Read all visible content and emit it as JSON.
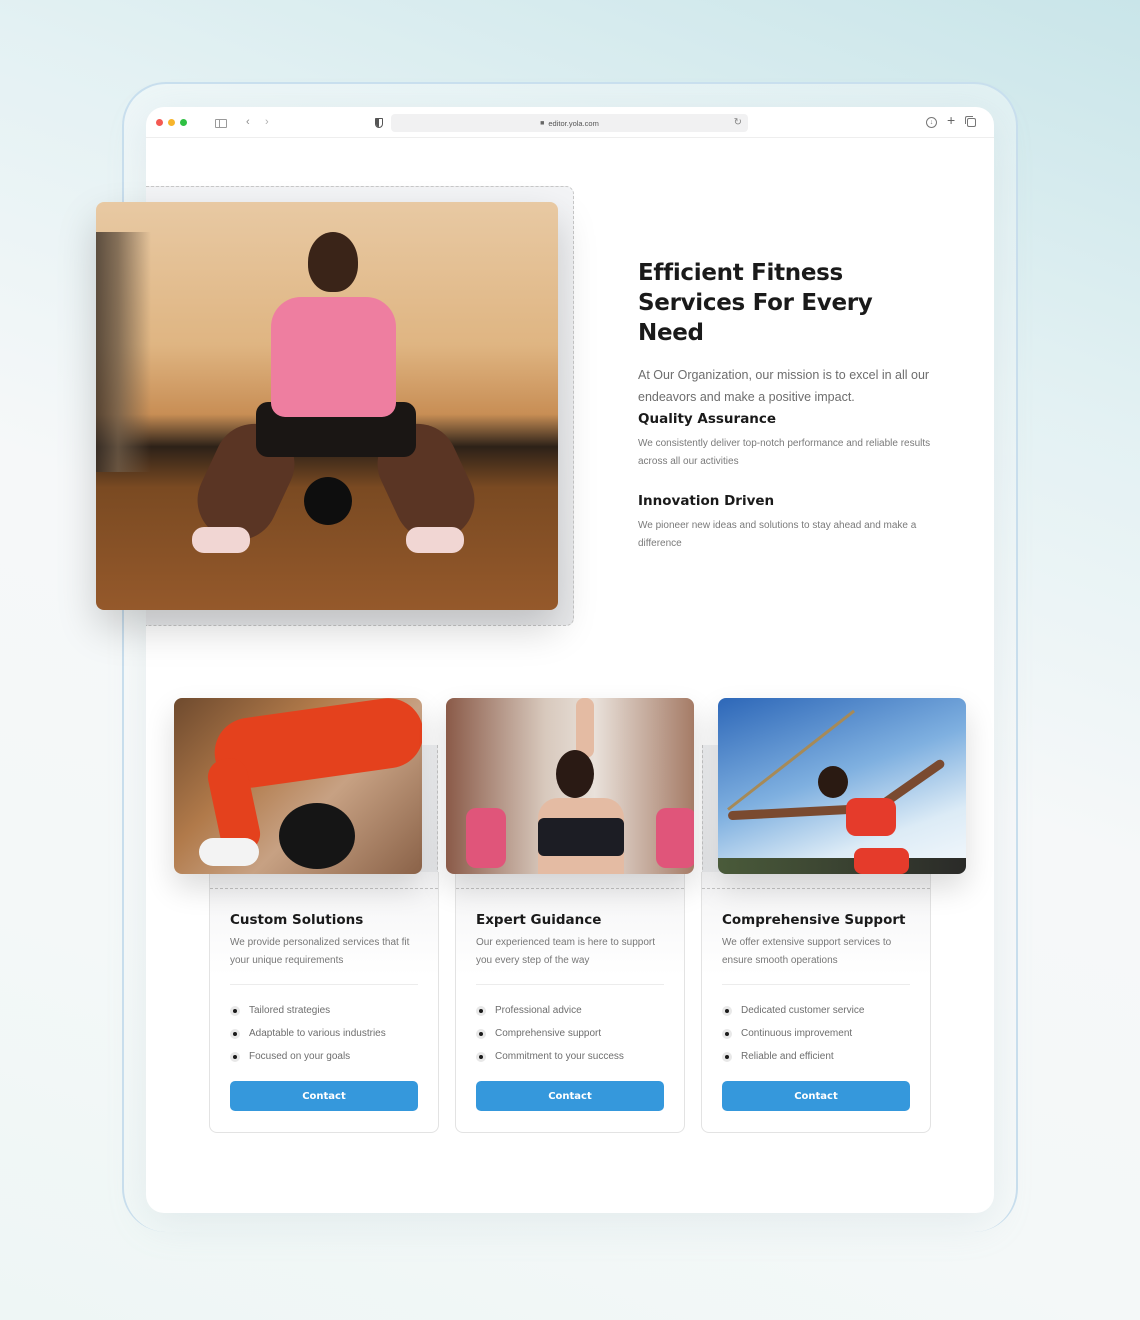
{
  "browser": {
    "url": "editor.yola.com",
    "icons": {
      "traffic_lights": [
        "close",
        "minimize",
        "maximize"
      ],
      "sidebar": "sidebar-toggle-icon",
      "back": "chevron-left-icon",
      "forward": "chevron-right-icon",
      "shield": "privacy-shield-icon",
      "lock": "lock-icon",
      "reload": "reload-icon",
      "download": "download-icon",
      "new_tab": "plus-icon",
      "tabs": "tab-overview-icon"
    },
    "glyphs": {
      "back": "‹",
      "forward": "›",
      "lock": "🔒",
      "reload": "↻",
      "download": "↓",
      "plus": "+"
    }
  },
  "hero": {
    "title": "Efficient Fitness Services For Every Need",
    "subtitle": "At Our Organization, our mission is to excel in all our endeavors and make a positive impact.",
    "image": "woman-kettlebell-squat-photo",
    "features": [
      {
        "title": "Quality Assurance",
        "description": "We consistently deliver top-notch performance and reliable results across all our activities"
      },
      {
        "title": "Innovation Driven",
        "description": "We pioneer new ideas and solutions to stay ahead and make a difference"
      }
    ]
  },
  "cards": [
    {
      "image": "barbell-workout-photo",
      "title": "Custom Solutions",
      "description": "We provide personalized services that fit your unique requirements",
      "items": [
        "Tailored strategies",
        "Adaptable to various industries",
        "Focused on your goals"
      ],
      "button": "Contact"
    },
    {
      "image": "dumbbell-class-photo",
      "title": "Expert Guidance",
      "description": "Our experienced team is here to support you every step of the way",
      "items": [
        "Professional advice",
        "Comprehensive support",
        "Commitment to your success"
      ],
      "button": "Contact"
    },
    {
      "image": "javelin-throw-photo",
      "title": "Comprehensive Support",
      "description": "We offer extensive support services to ensure smooth operations",
      "items": [
        "Dedicated customer service",
        "Continuous improvement",
        "Reliable and efficient"
      ],
      "button": "Contact"
    }
  ],
  "colors": {
    "accent": "#3598dc",
    "heading": "#1a1a1a",
    "body_text": "#6d6d6d",
    "traffic_red": "#f45952",
    "traffic_yellow": "#f7b52c",
    "traffic_green": "#2fc043"
  }
}
